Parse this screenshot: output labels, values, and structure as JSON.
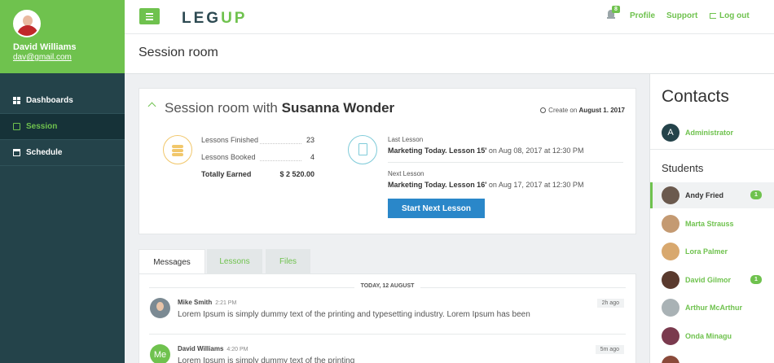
{
  "user": {
    "name": "David Williams",
    "email": "dav@gmail.com"
  },
  "nav": [
    {
      "label": "Dashboards",
      "icon": "grid-icon"
    },
    {
      "label": "Session",
      "icon": "copy-icon",
      "active": true
    },
    {
      "label": "Schedule",
      "icon": "calendar-icon"
    }
  ],
  "header": {
    "logo_a": "LEG",
    "logo_b": "UP",
    "notification_count": "8",
    "links": {
      "profile": "Profile",
      "support": "Support",
      "logout": "Log out"
    }
  },
  "page": {
    "title": "Session room"
  },
  "session": {
    "title_prefix": "Session room with ",
    "partner": "Susanna Wonder",
    "created_label": "Create on ",
    "created_date": "August 1. 2017",
    "stats": [
      {
        "label": "Lessons Finished",
        "value": "23"
      },
      {
        "label": "Lessons Booked",
        "value": "4"
      },
      {
        "label": "Totally Earned",
        "value": "$ 2 520.00"
      }
    ],
    "last_lesson": {
      "label": "Last Lesson",
      "title": "Marketing Today. Lesson 15'",
      "when": " on Aug 08, 2017 at 12:30 PM"
    },
    "next_lesson": {
      "label": "Next Lesson",
      "title": "Marketing Today. Lesson 16'",
      "when": " on Aug 17, 2017 at 12:30 PM"
    },
    "start_button": "Start Next Lesson"
  },
  "tabs": [
    "Messages",
    "Lessons",
    "Files"
  ],
  "messages": {
    "day": "TODAY, 12 AUGUST",
    "items": [
      {
        "author": "Mike Smith",
        "time": "2:21 PM",
        "text": "Lorem Ipsum is simply dummy text of the printing and typesetting industry. Lorem Ipsum has been",
        "ago": "2h ago"
      },
      {
        "author": "David Williams",
        "time": "4:20 PM",
        "text": "Lorem Ipsum is simply dummy text of the printing",
        "ago": "5m ago",
        "avatar": "Me"
      }
    ]
  },
  "contacts": {
    "title": "Contacts",
    "admin": {
      "initial": "A",
      "name": "Administrator"
    },
    "students_title": "Students",
    "students": [
      {
        "name": "Andy Fried",
        "badge": "1",
        "selected": true,
        "color": "#6b5a4e"
      },
      {
        "name": "Marta Strauss",
        "color": "#c49a72"
      },
      {
        "name": "Lora Palmer",
        "color": "#d8a86e"
      },
      {
        "name": "David Gilmor",
        "badge": "1",
        "color": "#5a3a2e"
      },
      {
        "name": "Arthur McArthur",
        "color": "#a9b2b5"
      },
      {
        "name": "Onda Minagu",
        "color": "#7a3a4e"
      },
      {
        "name": "",
        "color": "#8a4a3a"
      }
    ]
  },
  "colors": {
    "brand_green": "#6fc24e",
    "sidebar": "#24434a",
    "button_blue": "#2a87c9"
  }
}
